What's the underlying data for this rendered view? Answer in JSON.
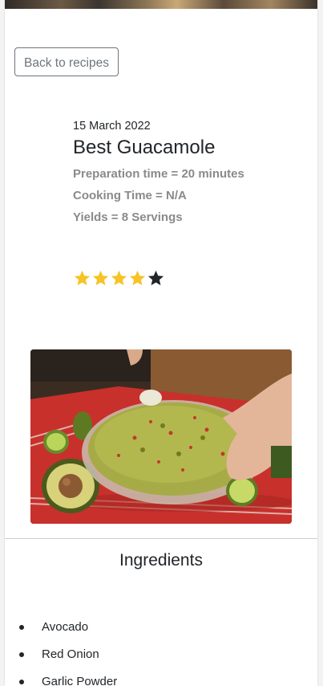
{
  "nav": {
    "back_label": "Back to recipes"
  },
  "recipe": {
    "date": "15 March 2022",
    "title": "Best Guacamole",
    "preparation": "Preparation time = 20 minutes",
    "cooking": "Cooking Time = N/A",
    "yields": "Yields = 8 Servings",
    "rating": {
      "value": 4,
      "max": 5
    }
  },
  "ingredients_section": {
    "title": "Ingredients",
    "items": [
      "Avocado",
      "Red Onion",
      "Garlic Powder"
    ]
  },
  "colors": {
    "star_filled": "#f7c325",
    "star_empty": "#212529",
    "button_border": "#6c757d",
    "meta_text": "#8a8a8a"
  }
}
